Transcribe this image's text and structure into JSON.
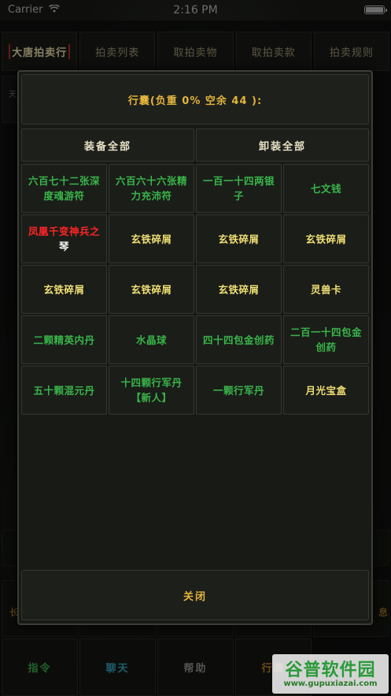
{
  "status_bar": {
    "carrier": "Carrier",
    "time": "2:16 PM"
  },
  "top_tabs": [
    "大唐拍卖行",
    "拍卖列表",
    "取拍卖物",
    "取拍卖款",
    "拍卖规则"
  ],
  "behind": {
    "left_strip_char": "天",
    "left_char": "长",
    "right_char": "息"
  },
  "modal": {
    "header": "行囊(负重 0% 空余 44 ):",
    "equip_all": "装备全部",
    "unequip_all": "卸装全部",
    "items": [
      {
        "text": "六百七十二张深度魂游符",
        "color": "green"
      },
      {
        "text": "六百六十六张精力充沛符",
        "color": "green"
      },
      {
        "text": "一百一十四两银子",
        "color": "green"
      },
      {
        "text": "七文钱",
        "color": "green"
      },
      {
        "text_red": "凤凰千变神兵之",
        "text_white": "琴",
        "color": "mixed"
      },
      {
        "text": "玄铁碎屑",
        "color": "yellow"
      },
      {
        "text": "玄铁碎屑",
        "color": "yellow"
      },
      {
        "text": "玄铁碎屑",
        "color": "yellow"
      },
      {
        "text": "玄铁碎屑",
        "color": "yellow"
      },
      {
        "text": "玄铁碎屑",
        "color": "yellow"
      },
      {
        "text": "玄铁碎屑",
        "color": "yellow"
      },
      {
        "text": "灵兽卡",
        "color": "yellow"
      },
      {
        "text": "二颗精英内丹",
        "color": "green"
      },
      {
        "text": "水晶球",
        "color": "green"
      },
      {
        "text": "四十四包金创药",
        "color": "green"
      },
      {
        "text": "二百一十四包金创药",
        "color": "green"
      },
      {
        "text": "五十颗混元丹",
        "color": "green"
      },
      {
        "text": "十四颗行军丹【新人】",
        "color": "green"
      },
      {
        "text": "一颗行军丹",
        "color": "green"
      },
      {
        "text": "月光宝盒",
        "color": "yellow"
      }
    ],
    "close": "关闭"
  },
  "bottom_nav": [
    "指令",
    "聊天",
    "帮助",
    "行囊"
  ],
  "watermark": {
    "title": "谷普软件园",
    "url": "www.gupuxiazai.com"
  }
}
